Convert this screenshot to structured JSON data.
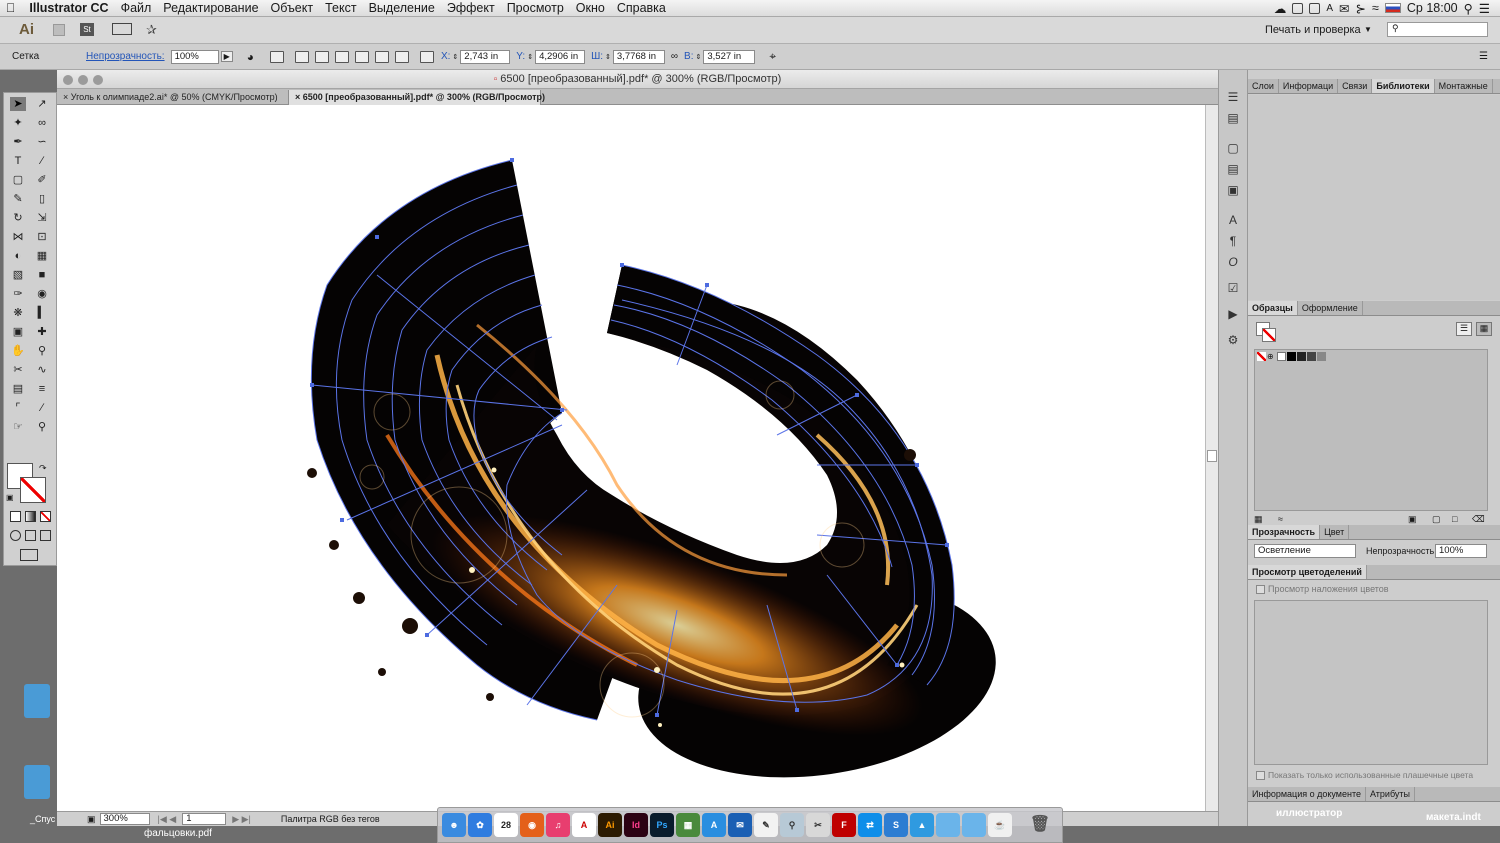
{
  "menubar": {
    "app": "Illustrator CC",
    "items": [
      "Файл",
      "Редактирование",
      "Объект",
      "Текст",
      "Выделение",
      "Эффект",
      "Просмотр",
      "Окно",
      "Справка"
    ],
    "clock": "Ср 18:00"
  },
  "appbar": {
    "logo": "Ai",
    "badge": "St",
    "workspace": "Печать и проверка",
    "search_placeholder": ""
  },
  "control": {
    "selection": "Сетка",
    "opacity_label": "Непрозрачность:",
    "opacity": "100%",
    "x_label": "X:",
    "x": "2,743 in",
    "y_label": "Y:",
    "y": "4,2906 in",
    "w_label": "Ш:",
    "w": "3,7768 in",
    "h_label": "В:",
    "h": "3,527 in"
  },
  "document": {
    "title": "6500 [преобразованный].pdf* @ 300% (RGB/Просмотр)",
    "tabs": [
      "Уголь к олимпиаде2.ai* @ 50% (CMYK/Просмотр)",
      "6500 [преобразованный].pdf* @ 300% (RGB/Просмотр)"
    ],
    "zoom": "300%",
    "artboard_num": "1",
    "status": "Палитра RGB без тегов"
  },
  "panels": {
    "top_tabs": [
      "Слои",
      "Информаци",
      "Связи",
      "Библиотеки",
      "Монтажные"
    ],
    "swatches_tabs": [
      "Образцы",
      "Оформление"
    ],
    "transparency_tabs": [
      "Прозрачность",
      "Цвет"
    ],
    "blend_mode": "Осветление",
    "opacity_label": "Непрозрачность:",
    "opacity": "100%",
    "separations_title": "Просмотр цветоделений",
    "overprint_label": "Просмотр наложения цветов",
    "spot_label": "Показать только использованные плашечные цвета",
    "bottom_tabs": [
      "Информация о документе",
      "Атрибуты"
    ]
  },
  "desktop": {
    "left_label": "_Спус",
    "file_label": "фальцовки.pdf",
    "folder1": "иллюстратор",
    "folder2": "макета.indt"
  },
  "dock": {
    "calendar": "28",
    "items": [
      "Finder",
      "Safari",
      "Календарь",
      "Firefox",
      "iTunes",
      "Acrobat",
      "Ai",
      "Id",
      "Ps",
      "Mission Control",
      "App Store",
      "Thunderbird",
      "TextEdit",
      "Preview",
      "Opera",
      "FileZilla",
      "TeamViewer",
      "Skype",
      "Dropbox",
      "Folder",
      "Folder",
      "Java",
      "Корзина"
    ]
  },
  "colors": {
    "accent": "#2b6fd1",
    "glow": "#ff8a1c",
    "artwork": "#050303"
  }
}
